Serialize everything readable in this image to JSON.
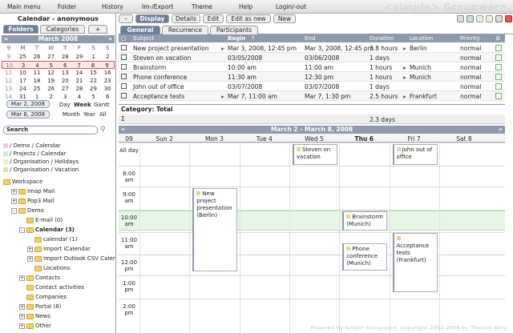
{
  "menu": [
    "Main menu",
    "Folder",
    "History",
    "Im-/Export",
    "Theme",
    "Help",
    "Login/-out"
  ],
  "brand": "<simple> Groupware",
  "left": {
    "title": "Calendar - anonymous",
    "tabs": [
      "Folders",
      "Categories",
      "+"
    ],
    "month_label": "March 2008",
    "weekday_headers": [
      "9",
      "M",
      "T",
      "W",
      "T",
      "F",
      "S",
      "S"
    ],
    "weeks": [
      [
        "9",
        "25",
        "26",
        "27",
        "28",
        "29",
        "1",
        "2"
      ],
      [
        "10",
        "3",
        "4",
        "5",
        "6",
        "7",
        "8",
        "9"
      ],
      [
        "11",
        "10",
        "11",
        "12",
        "13",
        "14",
        "15",
        "16"
      ],
      [
        "12",
        "17",
        "18",
        "19",
        "20",
        "21",
        "22",
        "23"
      ],
      [
        "13",
        "24",
        "25",
        "26",
        "27",
        "28",
        "29",
        "30"
      ],
      [
        "14",
        "31",
        "1",
        "2",
        "3",
        "4",
        "5",
        "6"
      ]
    ],
    "date_from": "Mar 2, 2008",
    "date_to": "Mar 8, 2008",
    "views_row1": [
      "Day",
      "Week",
      "Gantt"
    ],
    "views_row2": [
      "Month",
      "Year",
      "All"
    ],
    "search_placeholder": "Search",
    "categories": [
      {
        "label": "/ Demo / Calendar",
        "color": "#f0c8f0"
      },
      {
        "label": "/ Projects / Calendar",
        "color": "#c8f0c8"
      },
      {
        "label": "/ Organisation / Holidays",
        "color": "#f0f0c8"
      },
      {
        "label": "/ Organisation / Vacation",
        "color": "#f0d8b0"
      }
    ],
    "tree": [
      {
        "label": "Workspace",
        "level": 0,
        "pm": "-"
      },
      {
        "label": "Imap Mail",
        "level": 1,
        "pm": "+"
      },
      {
        "label": "Pop3 Mail",
        "level": 1,
        "pm": "+"
      },
      {
        "label": "Demo",
        "level": 1,
        "pm": "-"
      },
      {
        "label": "E-mail (0)",
        "level": 2,
        "pm": ""
      },
      {
        "label": "Calendar (3)",
        "level": 2,
        "pm": "-"
      },
      {
        "label": "calendar (1)",
        "level": 3,
        "pm": ""
      },
      {
        "label": "Import iCalendar",
        "level": 3,
        "pm": "+"
      },
      {
        "label": "Import Outlook CSV Calendar",
        "level": 3,
        "pm": "+"
      },
      {
        "label": "Locations",
        "level": 3,
        "pm": ""
      },
      {
        "label": "Contacts",
        "level": 2,
        "pm": "+"
      },
      {
        "label": "Contact activities",
        "level": 2,
        "pm": ""
      },
      {
        "label": "Companies",
        "level": 2,
        "pm": ""
      },
      {
        "label": "Portal (8)",
        "level": 2,
        "pm": "+"
      },
      {
        "label": "News",
        "level": 2,
        "pm": "+"
      },
      {
        "label": "Other",
        "level": 2,
        "pm": "+"
      }
    ]
  },
  "toolbar": {
    "buttons": [
      "–",
      "Display",
      "Details",
      "Edit",
      "Edit as new",
      "New"
    ],
    "active": "Display",
    "icons": [
      "refresh-icon",
      "tools-icon",
      "copy-icon",
      "paste-icon",
      "print-icon",
      "close-icon"
    ]
  },
  "subtabs": [
    "General",
    "Recurrence",
    "Participants"
  ],
  "columns": [
    "Subject",
    "Begin",
    "End",
    "Duration",
    "Location",
    "Priority"
  ],
  "rows": [
    {
      "subject": "New project presentation",
      "begin": "Mar 3, 2008, 12:45 pm",
      "end": "Mar 3, 2008, 12:45 pm",
      "duration": "3.8 hours",
      "location": "Berlin",
      "priority": "normal"
    },
    {
      "subject": "Steven on vacation",
      "begin": "03/05/2008",
      "end": "03/06/2008",
      "duration": "1 days",
      "location": "",
      "priority": "normal"
    },
    {
      "subject": "Brainstorm",
      "begin": "10:00 am",
      "end": "11:00 am",
      "duration": "1 hours",
      "location": "Munich",
      "priority": "normal"
    },
    {
      "subject": "Phone conference",
      "begin": "11:30 am",
      "end": "12:30 pm",
      "duration": "1 hours",
      "location": "Munich",
      "priority": "normal"
    },
    {
      "subject": "John out of office",
      "begin": "03/07/2008",
      "end": "03/07/2008",
      "duration": "1 days",
      "location": "",
      "priority": "normal"
    },
    {
      "subject": "Acceptance tests",
      "begin": "Mar 7, 11:00 am",
      "end": "Mar 7, 1:30 pm",
      "duration": "2.5 hours",
      "location": "Frankfurt",
      "priority": "normal"
    }
  ],
  "category_total_label": "Category: Total",
  "sum_symbol": "Σ",
  "sum_duration": "2.3 days",
  "week": {
    "title": "March 2 - March 8, 2008",
    "week_no": "09",
    "days": [
      "Sun 2",
      "Mon 3",
      "Tue 4",
      "Wed 5",
      "Thu 6",
      "Fri 7",
      "Sat 8"
    ],
    "hours": [
      "All day",
      "8:00 am",
      "9:00 am",
      "10:00 am",
      "11:00 am",
      "12:00 pm",
      "1:00 pm",
      "2:00 pm"
    ],
    "events": [
      {
        "label": "Steven on vacation"
      },
      {
        "label": "John out of office"
      },
      {
        "label": "New project presentation (Berlin)"
      },
      {
        "label": "Brainstorm (Munich)"
      },
      {
        "label": "Phone conference (Munich)"
      },
      {
        "label": "Acceptance tests (Frankfurt)"
      }
    ]
  },
  "footer": "Powered by Simple Groupware, Copyright 2002-2008 by Thomas Bley"
}
